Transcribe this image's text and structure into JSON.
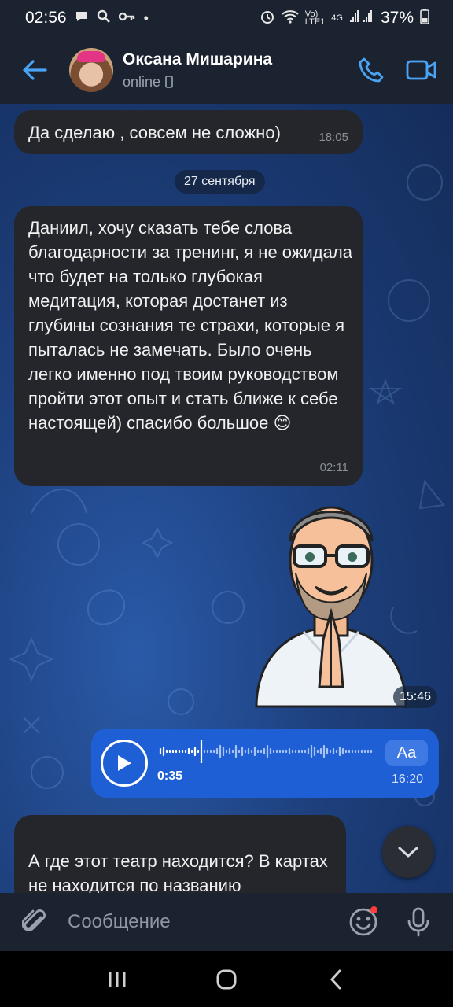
{
  "status": {
    "time": "02:56",
    "battery": "37%",
    "network": "4G"
  },
  "contact": {
    "name": "Оксана Мишарина",
    "status": "online"
  },
  "messages": [
    {
      "text": "Да сделаю , совсем не сложно)",
      "time": "18:05"
    },
    {
      "text": "Даниил, хочу сказать тебе слова благодарности за тренинг, я не ожидала что будет на только глубокая медитация, которая достанет из глубины сознания те страхи, которые я пыталась не замечать. Было очень легко именно под твоим руководством пройти этот опыт и стать ближе к себе настоящей) спасибо большое 😊",
      "time": "02:11"
    },
    {
      "text": "А где этот театр находится?  В картах не находится по названию\nИ какая стоимость? Длительность"
    }
  ],
  "date_separator": "27 сентября",
  "sticker": {
    "time": "15:46"
  },
  "voice": {
    "duration": "0:35",
    "time": "16:20",
    "transcribe_label": "Aa"
  },
  "input": {
    "placeholder": "Сообщение"
  },
  "colors": {
    "accent": "#1f5fd6",
    "bg": "#1c2330",
    "bubble": "#24262b"
  }
}
